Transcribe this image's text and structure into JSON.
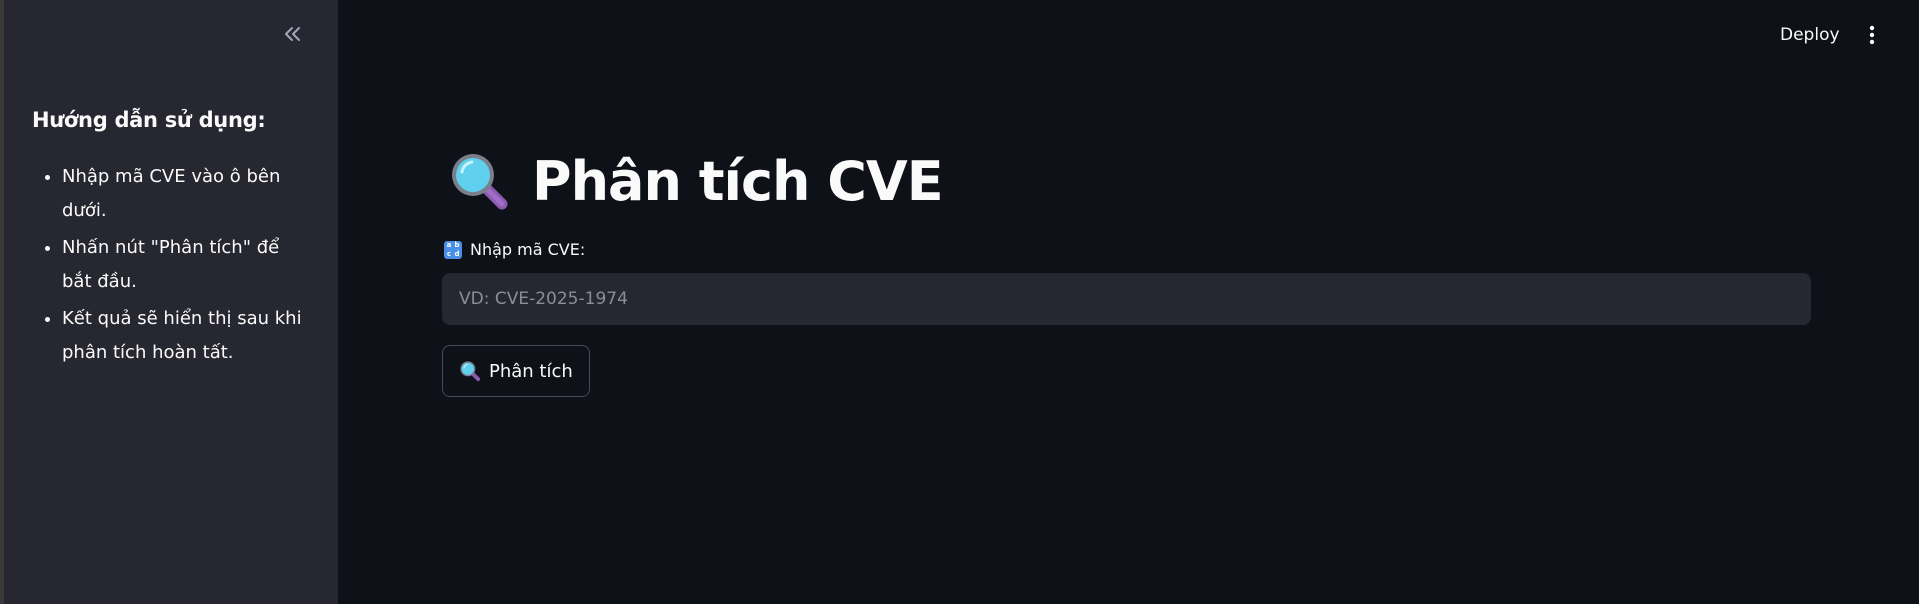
{
  "sidebar": {
    "heading": "Hướng dẫn sử dụng:",
    "instructions": [
      "Nhập mã CVE vào ô bên dưới.",
      "Nhấn nút \"Phân tích\" để bắt đầu.",
      "Kết quả sẽ hiển thị sau khi phân tích hoàn tất."
    ],
    "collapse_icon": "chevrons-left-icon"
  },
  "topbar": {
    "deploy_label": "Deploy",
    "menu_icon": "more-vertical-icon"
  },
  "main": {
    "title_icon": "magnifying-glass-icon",
    "title": "Phân tích CVE",
    "input": {
      "label_icon": "abcd-icon",
      "label": "Nhập mã CVE:",
      "placeholder": "VD: CVE-2025-1974",
      "value": ""
    },
    "analyze_button": {
      "icon": "magnifying-glass-icon",
      "label": "Phân tích"
    }
  },
  "colors": {
    "background": "#0e1117",
    "sidebar": "#262730",
    "input_bg": "#262730",
    "button_border": "#474a55",
    "text": "#fafafa",
    "placeholder": "#8b8e97"
  }
}
